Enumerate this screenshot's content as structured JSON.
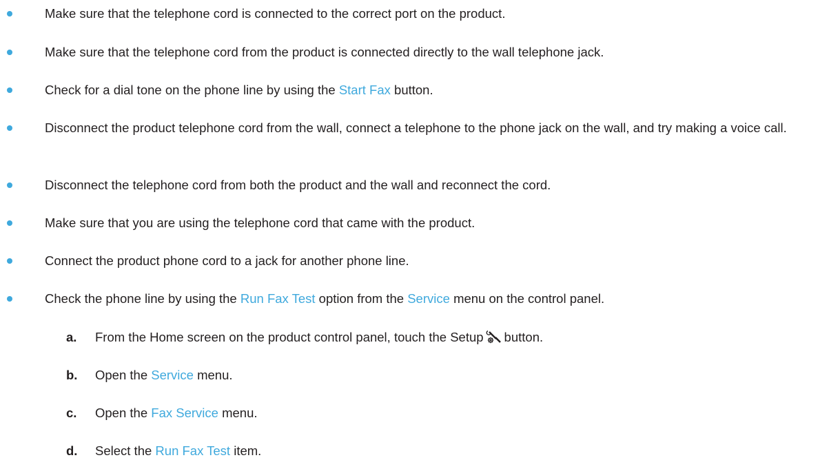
{
  "colors": {
    "accent": "#3fa9dd",
    "text": "#231f20"
  },
  "bullets": {
    "b1": {
      "text": "Make sure that the telephone cord is connected to the correct port on the product."
    },
    "b2": {
      "text": "Make sure that the telephone cord from the product is connected directly to the wall telephone jack."
    },
    "b3": {
      "pre": "Check for a dial tone on the phone line by using the",
      "link": "Start Fax",
      "post": "button."
    },
    "b4": {
      "text": "Disconnect the product telephone cord from the wall, connect a telephone to the phone jack on the wall, and try making a voice call."
    },
    "b5": {
      "text": "Disconnect the telephone cord from both the product and the wall and reconnect the cord."
    },
    "b6": {
      "text": "Make sure that you are using the telephone cord that came with the product."
    },
    "b7": {
      "text": "Connect the product phone cord to a jack for another phone line."
    },
    "b8": {
      "pre": "Check the phone line by using the",
      "link1": "Run Fax Test",
      "mid": "option from the",
      "link2": "Service",
      "post": "menu on the control panel."
    }
  },
  "steps": {
    "a": {
      "letter": "a.",
      "pre": "From the Home screen on the product control panel, touch the Setup",
      "icon": "setup-wrench-gear-icon",
      "post": "button."
    },
    "b": {
      "letter": "b.",
      "pre": "Open the",
      "link": "Service",
      "post": "menu."
    },
    "c": {
      "letter": "c.",
      "pre": "Open the",
      "link": "Fax Service",
      "post": "menu."
    },
    "d": {
      "letter": "d.",
      "pre": "Select the",
      "link": "Run Fax Test",
      "post": "item."
    }
  }
}
